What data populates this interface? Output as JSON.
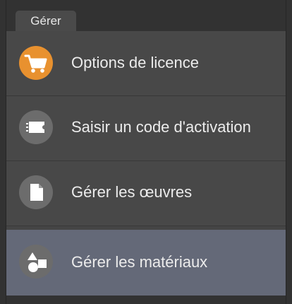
{
  "tab": {
    "label": "Gérer"
  },
  "menu": {
    "items": [
      {
        "label": "Options de licence",
        "icon": "cart-icon",
        "icon_color": "#E8912F",
        "selected": false
      },
      {
        "label": "Saisir un code d'activation",
        "icon": "ticket-icon",
        "icon_color": "#6C6C6C",
        "selected": false
      },
      {
        "label": "Gérer les œuvres",
        "icon": "document-icon",
        "icon_color": "#6C6C6C",
        "selected": false
      },
      {
        "label": "Gérer les matériaux",
        "icon": "shapes-icon",
        "icon_color": "#6C6C6C",
        "selected": true
      }
    ]
  },
  "colors": {
    "accent": "#E8912F",
    "selected_background": "#646978",
    "panel_background": "#484848"
  }
}
